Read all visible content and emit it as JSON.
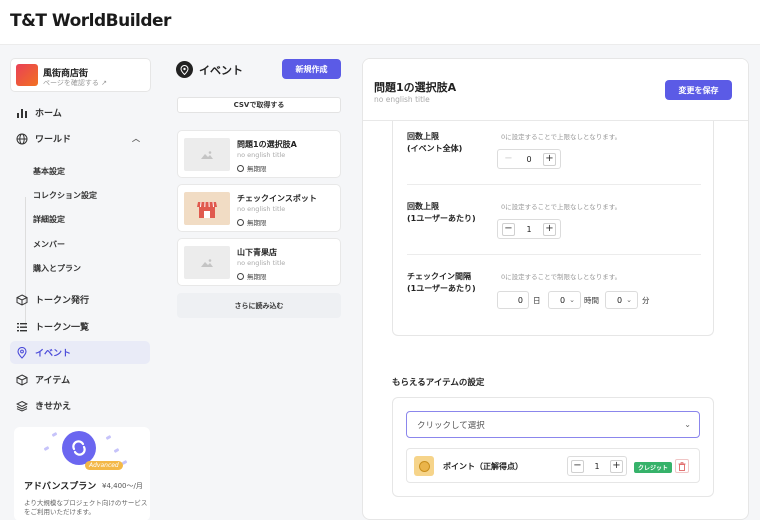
{
  "app": {
    "logo": "T&T WorldBuilder"
  },
  "sidebar": {
    "shop": {
      "name": "風街商店街",
      "link": "ページを確認する ↗"
    },
    "nav": [
      {
        "label": "ホーム",
        "icon": "bar-chart-icon"
      },
      {
        "label": "ワールド",
        "icon": "globe-icon",
        "expanded": true
      },
      {
        "label": "トークン発行",
        "icon": "cube-icon"
      },
      {
        "label": "トークン一覧",
        "icon": "list-icon"
      },
      {
        "label": "イベント",
        "icon": "location-pin-icon",
        "active": true
      },
      {
        "label": "アイテム",
        "icon": "box-icon"
      },
      {
        "label": "きせかえ",
        "icon": "layers-icon"
      }
    ],
    "sub": [
      "基本設定",
      "コレクション設定",
      "詳細設定",
      "メンバー",
      "購入とプラン"
    ],
    "plan": {
      "tag": "Advanced",
      "title": "アドバンスプラン",
      "price": "¥4,400〜/月",
      "desc": "より大規模なプロジェクト向けのサービスをご利用いただけます。"
    }
  },
  "events_panel": {
    "title": "イベント",
    "new_button": "新規作成",
    "csv_button": "CSVで取得する",
    "items": [
      {
        "name": "問題1の選択肢A",
        "sub": "no english title",
        "period": "無期限",
        "thumb": "placeholder-image-icon"
      },
      {
        "name": "チェックインスポット",
        "sub": "no english title",
        "period": "無期限",
        "thumb": "storefront-icon"
      },
      {
        "name": "山下青果店",
        "sub": "no english title",
        "period": "無期限",
        "thumb": "placeholder-image-icon"
      }
    ],
    "load_more": "さらに読み込む"
  },
  "detail": {
    "title": "問題1の選択肢A",
    "subtitle": "no english title",
    "save_button": "変更を保存",
    "rows": [
      {
        "label1": "回数上限",
        "label2": "(イベント全体)",
        "hint": "0に設定することで上限なしとなります。",
        "value": "0"
      },
      {
        "label1": "回数上限",
        "label2": "(1ユーザーあたり)",
        "hint": "0に設定することで上限なしとなります。",
        "value": "1"
      },
      {
        "label1": "チェックイン間隔",
        "label2": "(1ユーザーあたり)",
        "hint": "0に設定することで制限なしとなります。"
      }
    ],
    "interval": {
      "days": "0",
      "days_unit": "日",
      "hours": "0",
      "hours_unit": "時間",
      "minutes": "0",
      "minutes_unit": "分"
    },
    "reward": {
      "section_title": "もらえるアイテムの設定",
      "select_placeholder": "クリックして選択",
      "item_name": "ポイント（正解得点）",
      "quantity": "1",
      "badge": "クレジット"
    }
  },
  "colors": {
    "accent": "#5b5be6",
    "active_nav_bg": "#e9ebf7",
    "badge_green": "#36b26a"
  }
}
